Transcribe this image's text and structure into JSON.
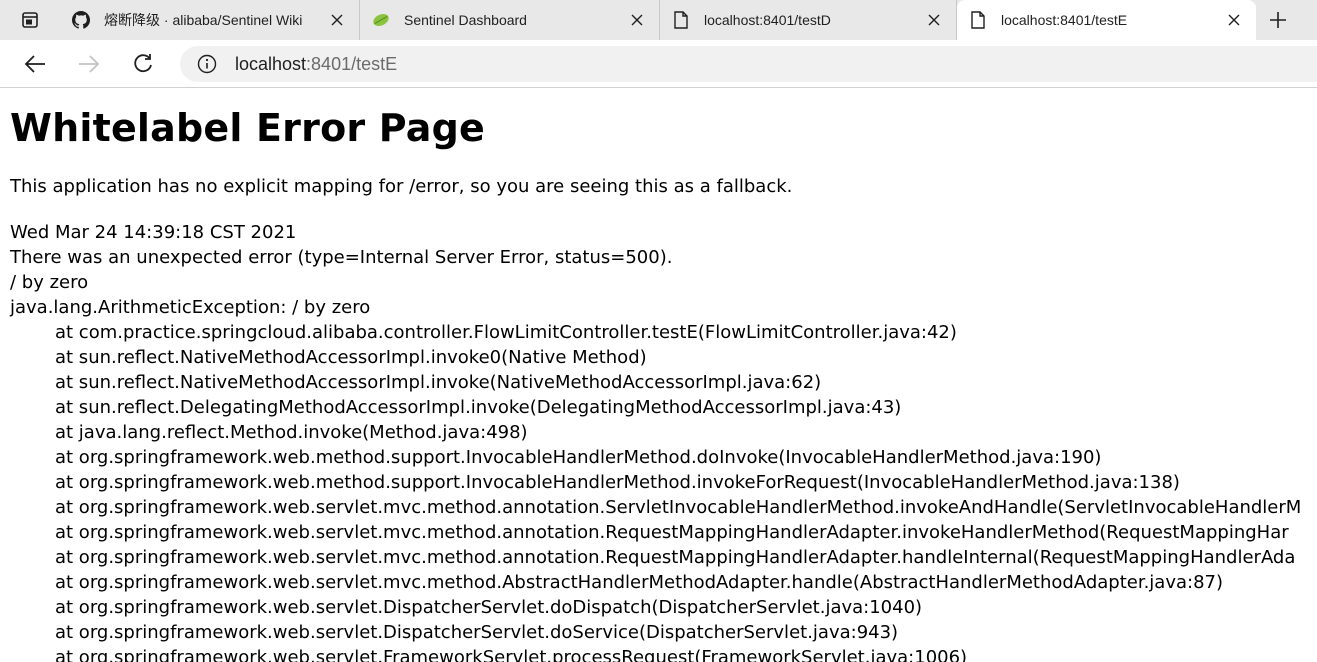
{
  "browser": {
    "tabs": [
      {
        "title": "熔断降级 · alibaba/Sentinel Wiki",
        "icon": "github-icon",
        "active": false
      },
      {
        "title": "Sentinel Dashboard",
        "icon": "leaf-icon",
        "active": false
      },
      {
        "title": "localhost:8401/testD",
        "icon": "page-icon",
        "active": false
      },
      {
        "title": "localhost:8401/testE",
        "icon": "page-icon",
        "active": true
      }
    ],
    "url_host": "localhost",
    "url_rest": ":8401/testE"
  },
  "page": {
    "heading": "Whitelabel Error Page",
    "description": "This application has no explicit mapping for /error, so you are seeing this as a fallback.",
    "timestamp": "Wed Mar 24 14:39:18 CST 2021",
    "error_summary": "There was an unexpected error (type=Internal Server Error, status=500).",
    "message": "/ by zero",
    "exception": "java.lang.ArithmeticException: / by zero",
    "stack": [
      "at com.practice.springcloud.alibaba.controller.FlowLimitController.testE(FlowLimitController.java:42)",
      "at sun.reflect.NativeMethodAccessorImpl.invoke0(Native Method)",
      "at sun.reflect.NativeMethodAccessorImpl.invoke(NativeMethodAccessorImpl.java:62)",
      "at sun.reflect.DelegatingMethodAccessorImpl.invoke(DelegatingMethodAccessorImpl.java:43)",
      "at java.lang.reflect.Method.invoke(Method.java:498)",
      "at org.springframework.web.method.support.InvocableHandlerMethod.doInvoke(InvocableHandlerMethod.java:190)",
      "at org.springframework.web.method.support.InvocableHandlerMethod.invokeForRequest(InvocableHandlerMethod.java:138)",
      "at org.springframework.web.servlet.mvc.method.annotation.ServletInvocableHandlerMethod.invokeAndHandle(ServletInvocableHandlerM",
      "at org.springframework.web.servlet.mvc.method.annotation.RequestMappingHandlerAdapter.invokeHandlerMethod(RequestMappingHar",
      "at org.springframework.web.servlet.mvc.method.annotation.RequestMappingHandlerAdapter.handleInternal(RequestMappingHandlerAda",
      "at org.springframework.web.servlet.mvc.method.AbstractHandlerMethodAdapter.handle(AbstractHandlerMethodAdapter.java:87)",
      "at org.springframework.web.servlet.DispatcherServlet.doDispatch(DispatcherServlet.java:1040)",
      "at org.springframework.web.servlet.DispatcherServlet.doService(DispatcherServlet.java:943)",
      "at org.springframework.web.servlet.FrameworkServlet.processRequest(FrameworkServlet.java:1006)"
    ]
  }
}
